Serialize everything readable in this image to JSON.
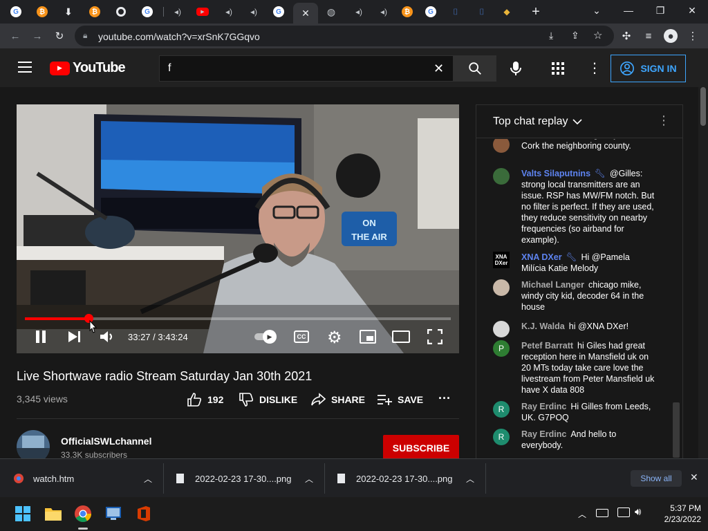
{
  "browser": {
    "url": "youtube.com/watch?v=xrSnK7GGqvo",
    "new_tab_symbol": "+",
    "tab_search_symbol": "⌄"
  },
  "youtube": {
    "logo_text": "YouTube",
    "search_value": "f",
    "signin_label": "SIGN IN"
  },
  "player": {
    "time": "33:27 / 3:43:24",
    "progress_fraction": 0.15,
    "poster_text": "ON THE AIR"
  },
  "video": {
    "title": "Live Shortwave radio Stream Saturday Jan 30th 2021",
    "views": "3,345 views",
    "likes": "192",
    "dislike_label": "DISLIKE",
    "share_label": "SHARE",
    "save_label": "SAVE"
  },
  "channel": {
    "name": "OfficialSWLchannel",
    "subscribers": "33.3K subscribers",
    "subscribe_label": "SUBSCRIBE"
  },
  "chat": {
    "header": "Top chat replay",
    "messages": [
      {
        "author": "",
        "text": "- that's cool, I'm originally from Cork the neighboring county.",
        "avatar_color": "#8a5a3c"
      },
      {
        "author": "Valts Silaputnins",
        "text": "@Gilles: strong local transmitters are an issue. RSP has MW/FM notch. But no filter is perfect. If they are used, they reduce sensitivity on nearby frequencies (so airband for example).",
        "avatar_color": "#3a6b3a",
        "moderator": true
      },
      {
        "author": "XNA DXer",
        "text": "Hi @Pamela Milícia Katie Melody",
        "avatar_text": "XNA\nDXer",
        "moderator": true
      },
      {
        "author": "Michael Langer",
        "text": "chicago mike, windy city kid, decoder 64 in the house",
        "avatar_color": "#c9b8a8"
      },
      {
        "author": "K.J. Walda",
        "text": "hi @XNA DXer!",
        "avatar_color": "#d8d8d8"
      },
      {
        "author": "Petef Barratt",
        "text": "hi Giles had great reception here in Mansfield uk on 20 MTs today take care love the livestream from Peter Mansfield uk have X data 808",
        "avatar_letter": "P",
        "avatar_color": "#2e7d32"
      },
      {
        "author": "Ray Erdinc",
        "text": "Hi Gilles from Leeds, UK. G7POQ",
        "avatar_letter": "R",
        "avatar_color": "#1e8c6e"
      },
      {
        "author": "Ray Erdinc",
        "text": "And hello to everybody.",
        "avatar_letter": "R",
        "avatar_color": "#1e8c6e"
      }
    ]
  },
  "downloads": {
    "items": [
      {
        "name": "watch.htm"
      },
      {
        "name": "2022-02-23 17-30....png"
      },
      {
        "name": "2022-02-23 17-30....png"
      }
    ],
    "show_all": "Show all"
  },
  "taskbar": {
    "time": "5:37 PM",
    "date": "2/23/2022"
  }
}
